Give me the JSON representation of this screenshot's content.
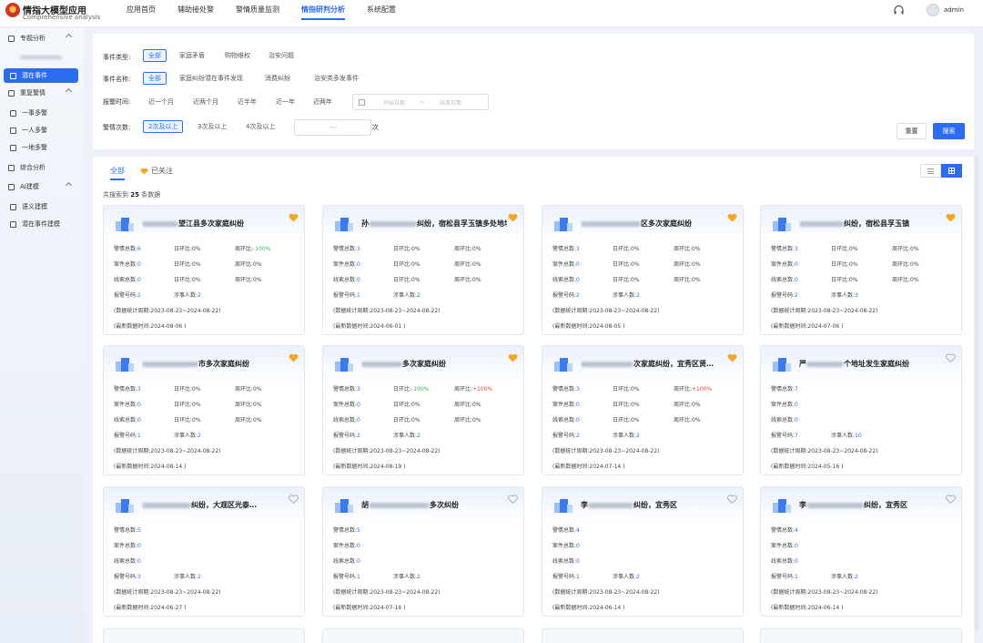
{
  "app": {
    "title": "情指大模型应用",
    "subtitle": "Comprehensive analysis"
  },
  "nav": [
    "应用首页",
    "辅助接处警",
    "警情质量监测",
    "情指研判分析",
    "系统配置"
  ],
  "nav_active": 3,
  "user": {
    "name": "admin"
  },
  "sidebar": {
    "items": [
      {
        "label": "专题分析",
        "kind": "group",
        "icon": "topic-icon"
      },
      {
        "label": "",
        "kind": "blurred"
      },
      {
        "label": "潜在事件",
        "kind": "active",
        "icon": "grid-icon"
      },
      {
        "label": "重复警情",
        "kind": "group",
        "icon": "repeat-icon"
      },
      {
        "label": "一事多警",
        "kind": "sub",
        "icon": "grid-icon"
      },
      {
        "label": "一人多警",
        "kind": "sub",
        "icon": "grid-icon"
      },
      {
        "label": "一地多警",
        "kind": "sub",
        "icon": "grid-icon"
      },
      {
        "label": "综合分析",
        "kind": "item",
        "icon": "shield-icon"
      },
      {
        "label": "AI建模",
        "kind": "group",
        "icon": "ai-icon"
      },
      {
        "label": "语义建模",
        "kind": "sub",
        "icon": "grid-icon"
      },
      {
        "label": "潜在事件建模",
        "kind": "sub",
        "icon": "grid-icon"
      }
    ]
  },
  "filter": {
    "event_type_label": "事件类型:",
    "event_types": [
      "全部",
      "家庭矛盾",
      "购物维权",
      "治安问题"
    ],
    "event_name_label": "事件名称:",
    "event_names": [
      "全部",
      "家庭纠纷潜在事件发现",
      "消费纠纷",
      "治安类多发事件"
    ],
    "time_label": "报警时间:",
    "times": [
      "近一个月",
      "近两个月",
      "近半年",
      "近一年",
      "近两年"
    ],
    "date_start": "开始日期",
    "date_sep": "~",
    "date_end": "结束日期",
    "count_label": "警情次数:",
    "counts": [
      "2次及以上",
      "3次及以上",
      "4次及以上"
    ],
    "count_input": "---",
    "count_unit": "次",
    "reset": "重置",
    "search": "搜索"
  },
  "tabs": {
    "all": "全部",
    "fav": "已关注"
  },
  "result": {
    "prefix": "共搜索到 ",
    "num": "25",
    "suffix": " 条数据"
  },
  "labels": {
    "alarm_total": "警情总数:",
    "case_total": "案件总数:",
    "clue_total": "线索总数:",
    "dod": "日环比:",
    "wow": "周环比:",
    "callers": "报警号码:",
    "people": "涉事人数:",
    "period": "(数据统计周期:",
    "latest": "(最新数据时间:"
  },
  "colors": {
    "accent": "#2c6cf0",
    "gold": "#f5a623",
    "up": "#e84b3c",
    "down": "#3fb35b"
  },
  "cards": [
    {
      "title_pre": "",
      "title_post": "望江县多次家庭纠纷",
      "fav": true,
      "alarm": "6",
      "case": "0",
      "clue": "0",
      "full": true,
      "ad": "0%",
      "aw": "-100%",
      "cd": "0%",
      "cw": "0%",
      "ld": "0%",
      "lw": "0%",
      "callers": "1",
      "people": "2",
      "period": "2023-08-23~2024-08-22)",
      "latest": "2024-08-06 )"
    },
    {
      "title_pre": "孙",
      "title_post": "纠纷，宿松县孚玉镇多处地址",
      "fav": true,
      "alarm": "3",
      "case": "0",
      "clue": "0",
      "full": true,
      "ad": "0%",
      "aw": "0%",
      "cd": "0%",
      "cw": "0%",
      "ld": "0%",
      "lw": "0%",
      "callers": "1",
      "people": "2",
      "period": "2023-08-23~2024-08-22)",
      "latest": "2024-06-01 )"
    },
    {
      "title_pre": "",
      "title_post": "区多次家庭纠纷",
      "fav": true,
      "alarm": "3",
      "case": "0",
      "clue": "0",
      "full": true,
      "ad": "0%",
      "aw": "0%",
      "cd": "0%",
      "cw": "0%",
      "ld": "0%",
      "lw": "0%",
      "callers": "2",
      "people": "2",
      "period": "2023-08-23~2024-08-22)",
      "latest": "2024-08-05 )"
    },
    {
      "title_pre": "",
      "title_post": "纠纷，宿松县孚玉镇",
      "fav": true,
      "alarm": "3",
      "case": "0",
      "clue": "0",
      "full": true,
      "ad": "0%",
      "aw": "0%",
      "cd": "0%",
      "cw": "0%",
      "ld": "0%",
      "lw": "0%",
      "callers": "2",
      "people": "3",
      "period": "2023-08-23~2024-08-22)",
      "latest": "2024-07-06 )"
    },
    {
      "title_pre": "",
      "title_post": "市多次家庭纠纷",
      "fav": true,
      "alarm": "3",
      "case": "0",
      "clue": "0",
      "full": true,
      "ad": "0%",
      "aw": "0%",
      "cd": "0%",
      "cw": "0%",
      "ld": "0%",
      "lw": "0%",
      "callers": "1",
      "people": "2",
      "period": "2023-08-23~2024-08-22)",
      "latest": "2024-08-14 )"
    },
    {
      "title_pre": "",
      "title_post": "多次家庭纠纷",
      "fav": true,
      "alarm": "3",
      "case": "0",
      "clue": "0",
      "full": true,
      "ad": "-100%",
      "aw": "+100%",
      "cd": "0%",
      "cw": "0%",
      "ld": "0%",
      "lw": "0%",
      "callers": "2",
      "people": "2",
      "period": "2023-08-23~2024-08-22)",
      "latest": "2024-08-19 )"
    },
    {
      "title_pre": "",
      "title_post": "次家庭纠纷，宜秀区贤…",
      "fav": true,
      "alarm": "3",
      "case": "0",
      "clue": "0",
      "full": true,
      "ad": "0%",
      "aw": "+100%",
      "cd": "0%",
      "cw": "0%",
      "ld": "0%",
      "lw": "0%",
      "callers": "2",
      "people": "2",
      "period": "2023-08-23~2024-08-22)",
      "latest": "2024-07-14 )"
    },
    {
      "title_pre": "严",
      "title_post": "个地址发生家庭纠纷",
      "fav": false,
      "alarm": "7",
      "case": "0",
      "clue": "0",
      "full": false,
      "callers": "7",
      "people": "10",
      "period": "2023-08-23~2024-08-22)",
      "latest": "2024-05-16 )"
    },
    {
      "title_pre": "",
      "title_post": "纠纷，大观区光泰…",
      "fav": false,
      "alarm": "5",
      "case": "0",
      "clue": "0",
      "full": false,
      "callers": "3",
      "people": "2",
      "period": "2023-08-23~2024-08-22)",
      "latest": "2024-06-27 )"
    },
    {
      "title_pre": "胡",
      "title_post": "多次纠纷",
      "fav": false,
      "alarm": "5",
      "case": "0",
      "clue": "0",
      "full": false,
      "callers": "1",
      "people": "2",
      "period": "2023-08-23~2024-08-22)",
      "latest": "2024-07-16 )"
    },
    {
      "title_pre": "李",
      "title_post": "纠纷，宜秀区",
      "fav": false,
      "alarm": "4",
      "case": "0",
      "clue": "0",
      "full": false,
      "callers": "1",
      "people": "2",
      "period": "2023-08-23~2024-08-22)",
      "latest": "2024-06-14 )"
    },
    {
      "title_pre": "李",
      "title_post": "纠纷，宜秀区",
      "fav": false,
      "alarm": "4",
      "case": "0",
      "clue": "0",
      "full": false,
      "callers": "1",
      "people": "2",
      "period": "2023-08-23~2024-08-22)",
      "latest": "2024-06-14 )"
    }
  ]
}
